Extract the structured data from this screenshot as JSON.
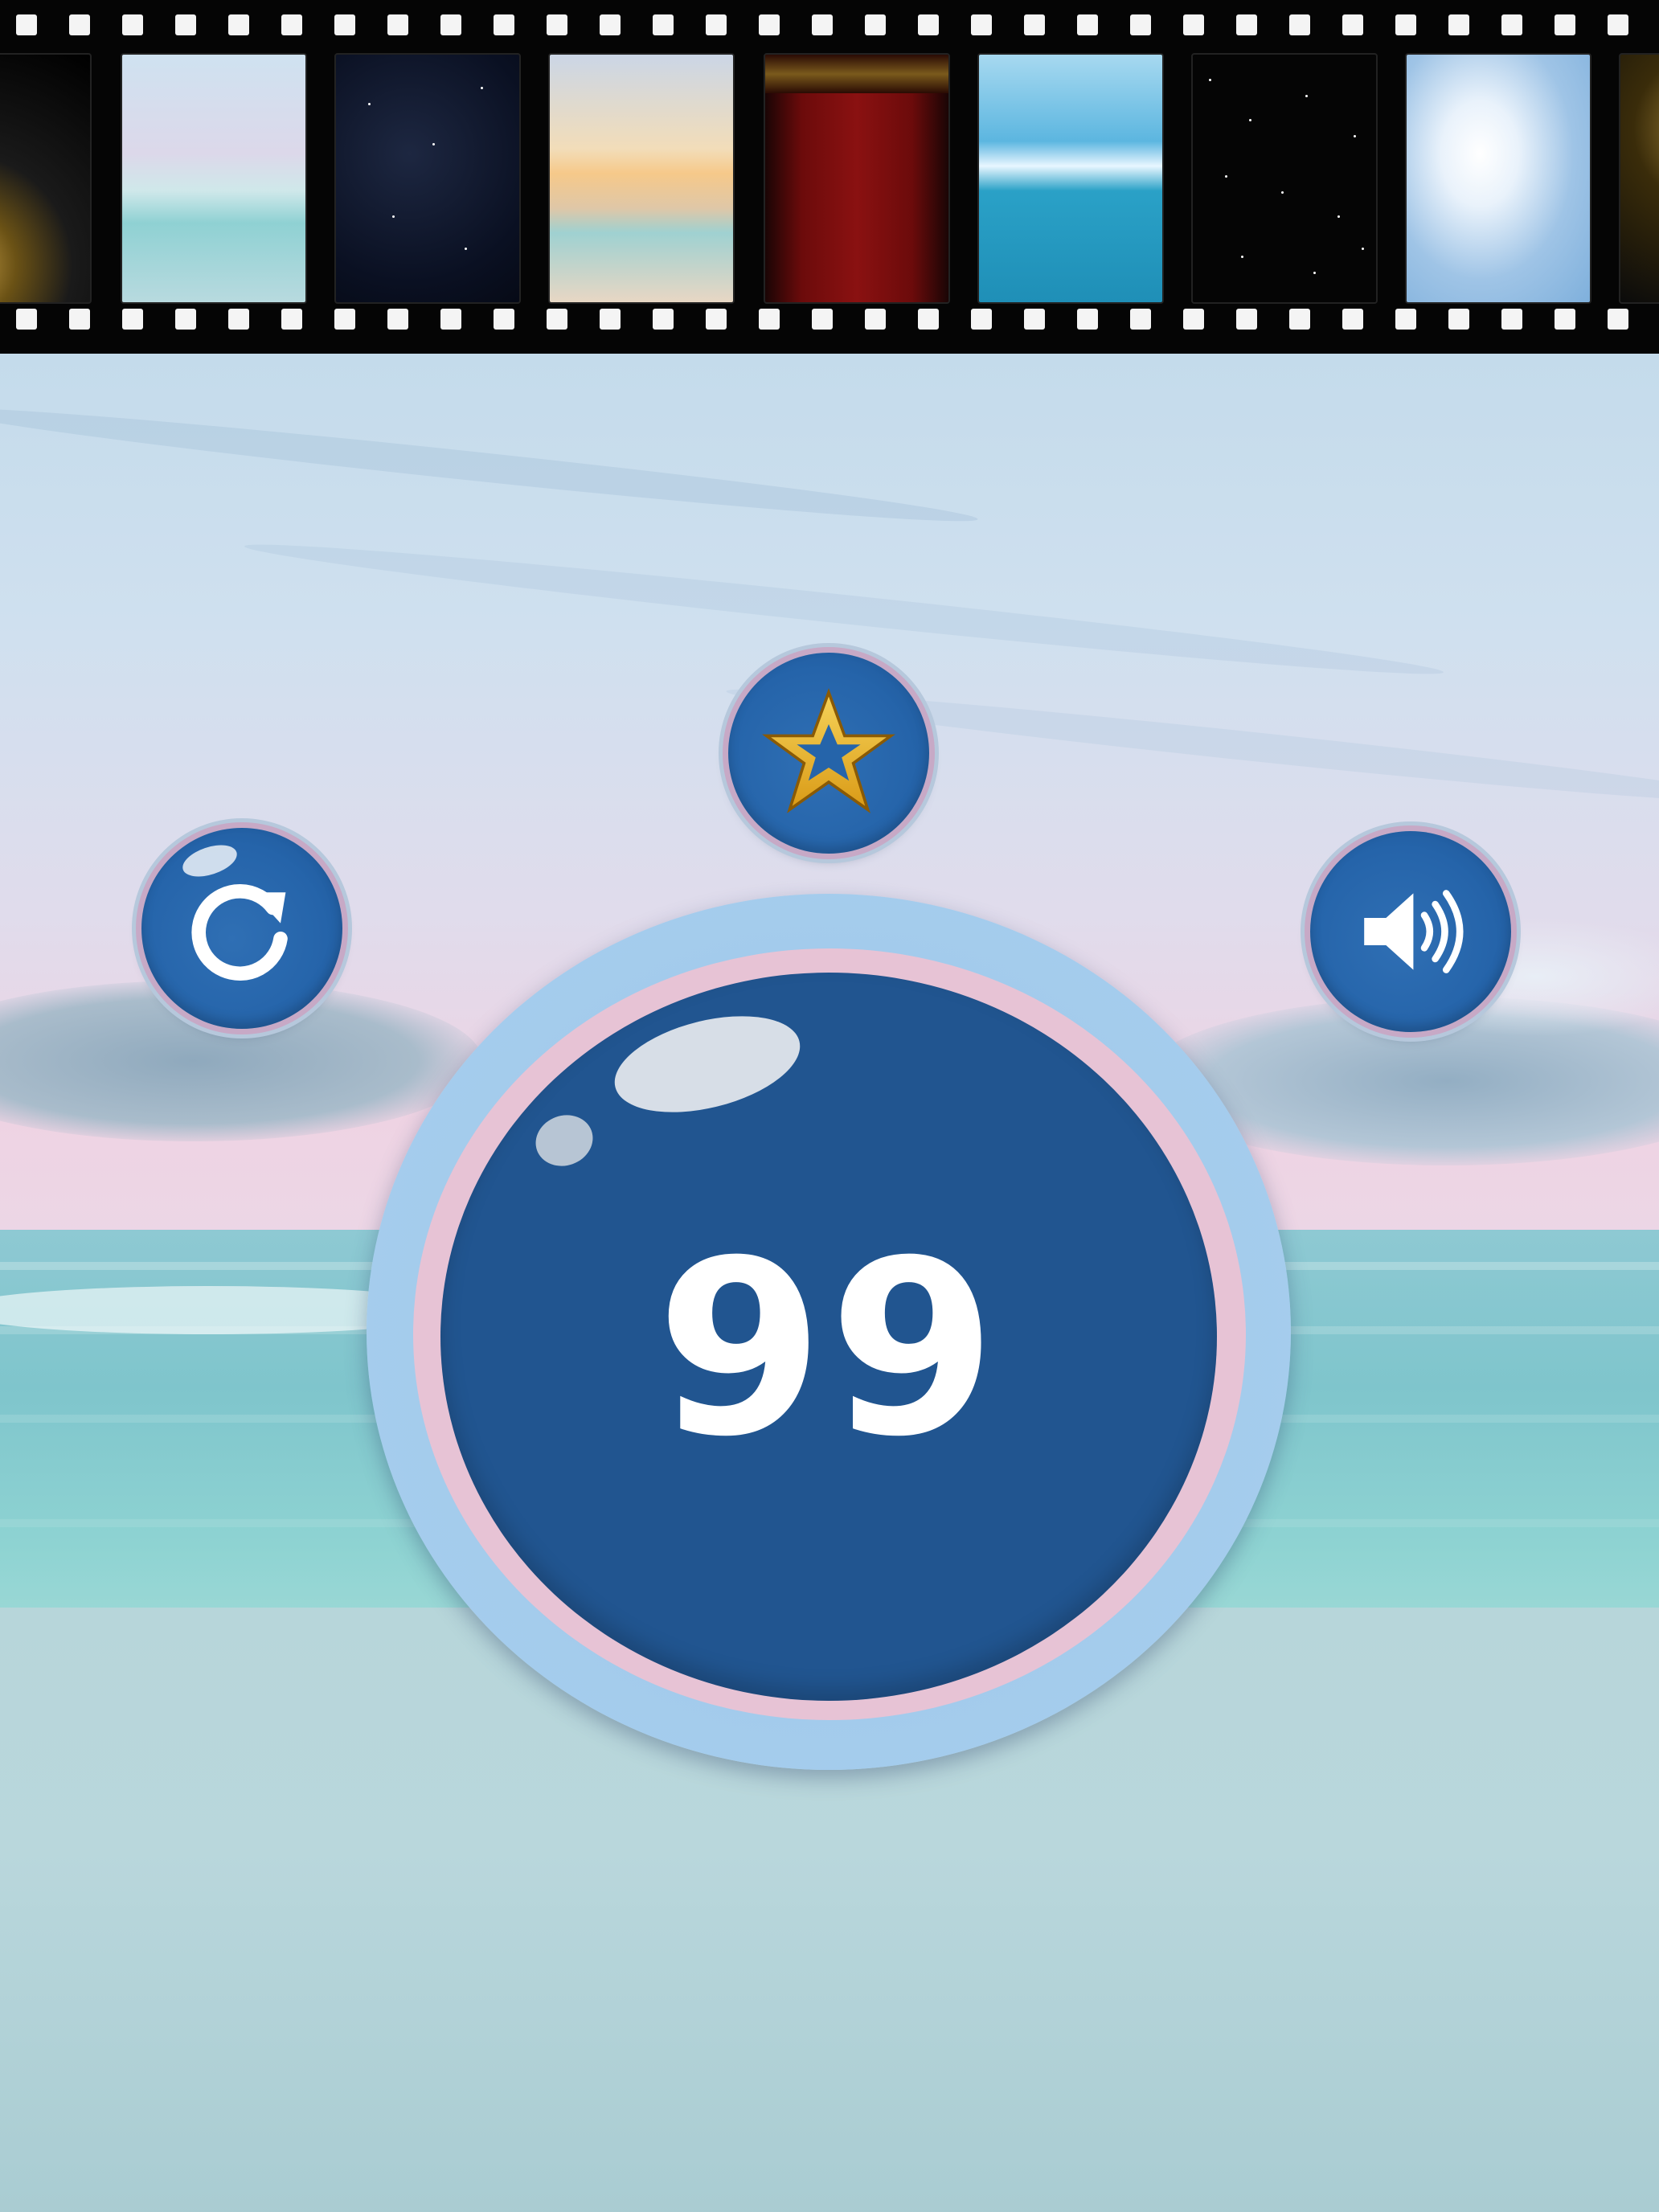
{
  "app": {
    "counter_value": "99",
    "colors": {
      "button_blue": "#2564aa",
      "counter_blue": "#215590",
      "ring_pink": "#e7c3d5",
      "ring_blue": "#a9d0ef",
      "star_gold": "#e6b22a"
    }
  },
  "filmstrip": {
    "themes": [
      {
        "id": "gold-frame",
        "icon": "gold-curtain-thumbnail"
      },
      {
        "id": "pastel-beach",
        "icon": "beach-thumbnail"
      },
      {
        "id": "night-sky",
        "icon": "night-sky-thumbnail"
      },
      {
        "id": "sunset-beach",
        "icon": "sunset-thumbnail"
      },
      {
        "id": "red-curtain",
        "icon": "curtain-thumbnail"
      },
      {
        "id": "ocean-sun",
        "icon": "ocean-thumbnail"
      },
      {
        "id": "starfield",
        "icon": "starfield-thumbnail"
      },
      {
        "id": "clouds",
        "icon": "clouds-thumbnail"
      },
      {
        "id": "gold-frame-2",
        "icon": "gold-curtain-thumbnail"
      }
    ]
  },
  "controls": {
    "reset_icon": "refresh-icon",
    "favorite_icon": "star-icon",
    "sound_icon": "speaker-icon"
  }
}
